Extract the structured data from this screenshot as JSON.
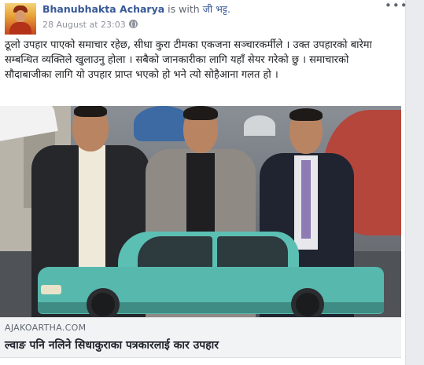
{
  "post": {
    "author": "Bhanubhakta Acharya",
    "with_text": "is with",
    "tagged_person": "जी भट्ट.",
    "timestamp": "28 August at 23:03",
    "privacy_icon": "globe-icon",
    "options_icon": "more-options-icon",
    "options_label": "•••",
    "text": "ठूलो उपहार पाएको समाचार रहेछ, सीधा कुरा टीमका एकजना सञ्चारकर्मीले । उक्त उपहारको बारेमा सम्बन्धित व्यक्तिले खुलाउनु होला । सबैको जानकारीका लागि यहाँ सेयर गरेको छु । समाचारको सौदाबाजीका लागि यो उपहार प्राप्त भएको हो भने त्यो सोहैआना गलत हो ।"
  },
  "link_preview": {
    "domain": "AJAKOARTHA.COM",
    "title": "ल्वाङ पनि नलिने सिधाकुराका पत्रकारलाई कार उपहार"
  },
  "colors": {
    "link_blue": "#385898",
    "car": "#57b8ad",
    "page_bg": "#e9ebee"
  }
}
